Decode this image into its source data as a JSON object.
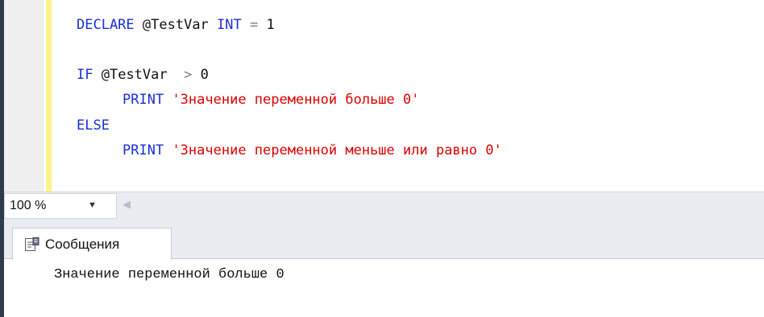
{
  "editor": {
    "line1": {
      "kw_declare": "DECLARE",
      "var": "@TestVar",
      "kw_int": "INT",
      "op_eq": "=",
      "value": "1"
    },
    "line3": {
      "kw_if": "IF",
      "var": "@TestVar",
      "op_gt": ">",
      "value": "0"
    },
    "line4": {
      "kw_print": "PRINT",
      "string": "'Значение переменной больше 0'"
    },
    "line5": {
      "kw_else": "ELSE"
    },
    "line6": {
      "kw_print": "PRINT",
      "string": "'Значение переменной меньше или равно 0'"
    }
  },
  "zoom": {
    "value": "100 %"
  },
  "results": {
    "tab_label": "Сообщения",
    "tab_icon": "messages-icon",
    "message": "Значение переменной больше 0"
  },
  "colors": {
    "keyword": "#1a2fd6",
    "string": "#e00000",
    "operator": "#7f7f7f",
    "change_bar": "#fff28a",
    "window_edge": "#303a4e"
  }
}
